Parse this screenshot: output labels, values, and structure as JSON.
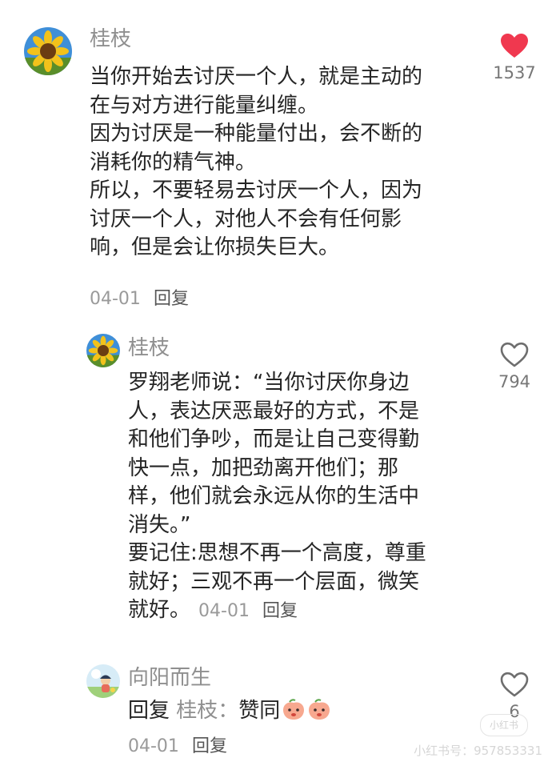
{
  "comments": [
    {
      "author": "桂枝",
      "text": "当你开始去讨厌一个人，就是主动的\n在与对方进行能量纠缠。\n因为讨厌是一种能量付出，会不断的\n消耗你的精气神。\n所以，不要轻易去讨厌一个人，因为\n讨厌一个人，对他人不会有任何影\n响，但是会让你损失巨大。",
      "date": "04-01",
      "reply_label": "回复",
      "likes": "1537",
      "liked": true,
      "avatar": "sunflower"
    },
    {
      "author": "桂枝",
      "text": "罗翔老师说：“当你讨厌你身边\n人，表达厌恶最好的方式，不是\n和他们争吵，而是让自己变得勤\n快一点，加把劲离开他们；那\n样，他们就会永远从你的生活中\n消失。”\n要记住:思想不再一个高度，尊重\n就好；三观不再一个层面，微笑\n就好。",
      "date": "04-01",
      "reply_label": "回复",
      "likes": "794",
      "liked": false,
      "avatar": "sunflower"
    },
    {
      "author": "向阳而生",
      "reply_prefix": "回复",
      "reply_target": "桂枝：",
      "text": "赞同",
      "date": "04-01",
      "reply_label": "回复",
      "likes": "6",
      "liked": false,
      "avatar": "cartoon-child",
      "emojis": [
        "peach-face-emoji",
        "peach-face-emoji"
      ]
    }
  ],
  "colors": {
    "liked_heart": "#f0384f",
    "meta_gray": "#9a9a9a",
    "name_gray": "#8f8f8f"
  },
  "watermark": {
    "logo": "小红书",
    "text": "小红书号：957853331"
  }
}
